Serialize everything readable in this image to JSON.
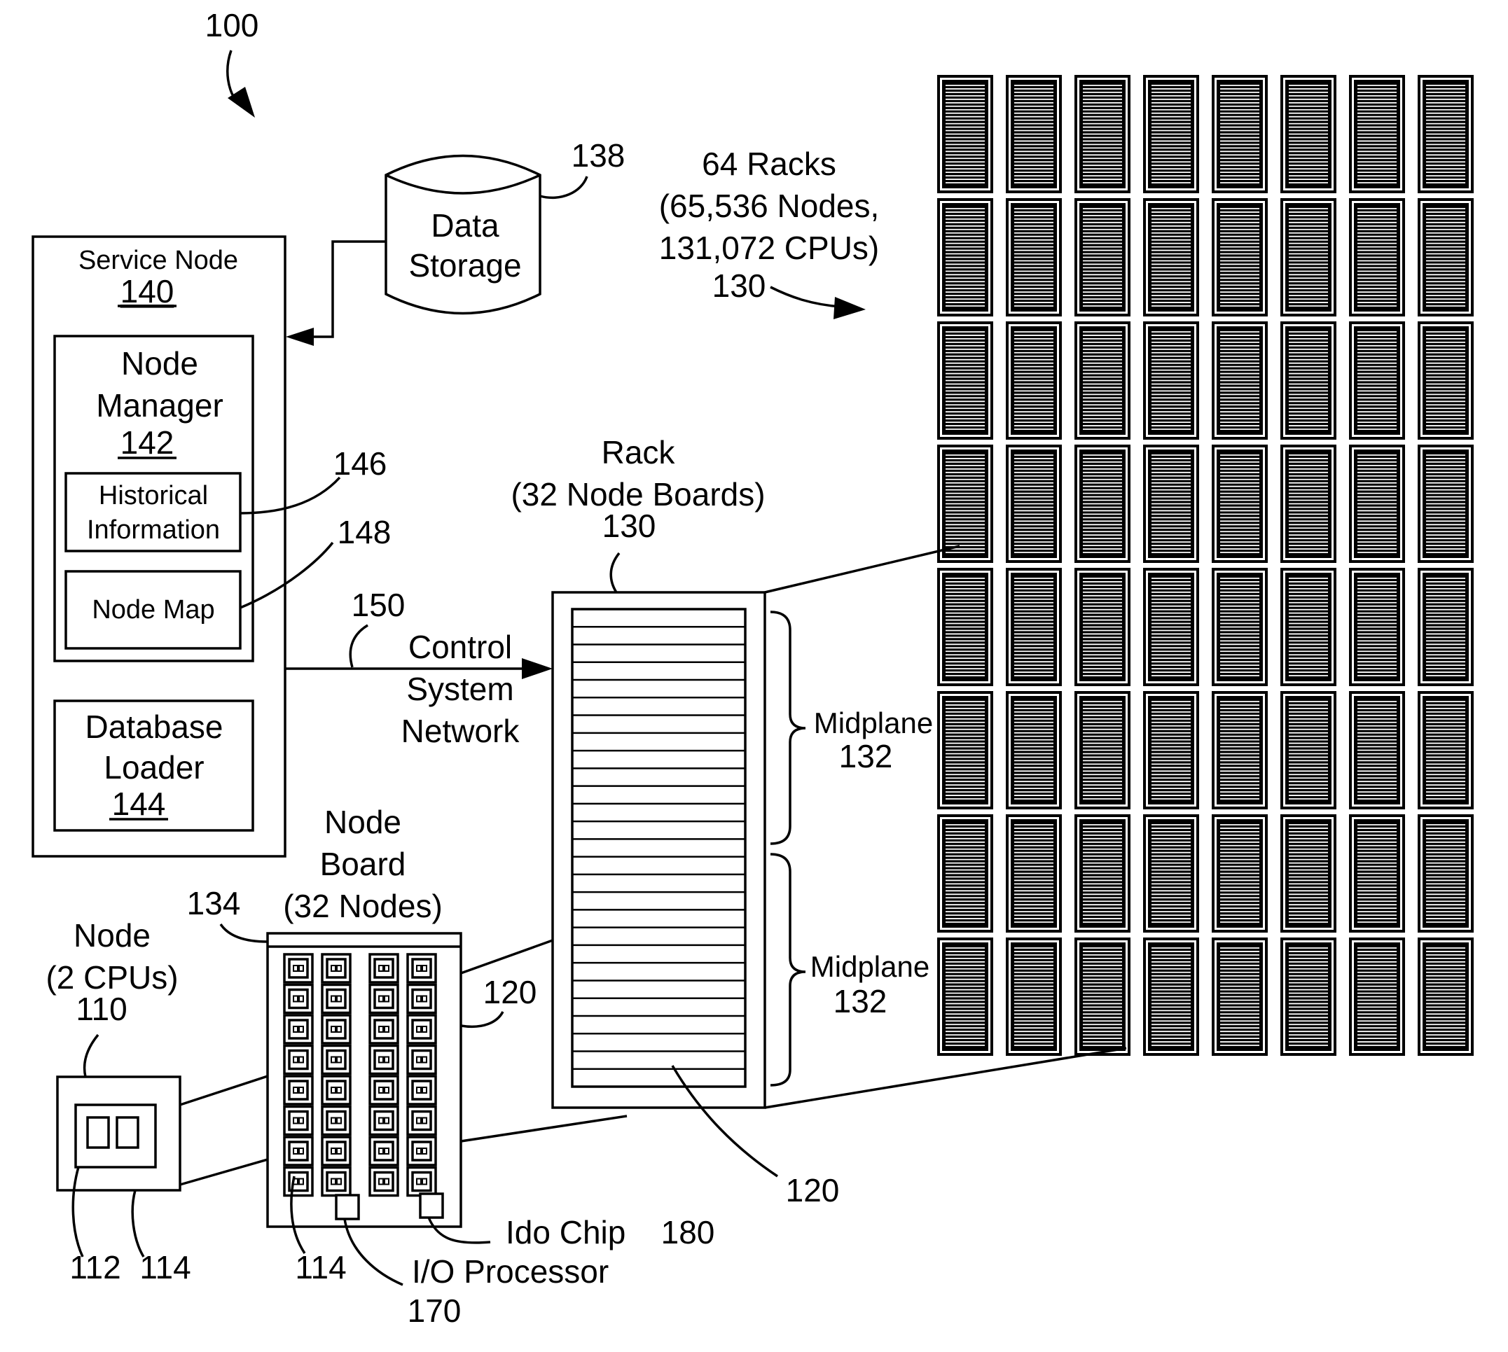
{
  "figure": {
    "ref": "100"
  },
  "data_storage": {
    "line1": "Data",
    "line2": "Storage",
    "ref": "138"
  },
  "service_node": {
    "title": "Service Node",
    "ref": "140",
    "node_manager": {
      "line1": "Node",
      "line2": "Manager",
      "ref": "142"
    },
    "historical_information": {
      "line1": "Historical",
      "line2": "Information",
      "ref": "146"
    },
    "node_map": {
      "label": "Node Map",
      "ref": "148"
    },
    "database_loader": {
      "line1": "Database",
      "line2": "Loader",
      "ref": "144"
    }
  },
  "control_network": {
    "ref": "150",
    "line1": "Control",
    "line2": "System",
    "line3": "Network"
  },
  "racks_system": {
    "line1": "64 Racks",
    "line2": "(65,536 Nodes,",
    "line3": "131,072 CPUs)",
    "ref": "130",
    "columns": 8,
    "rows": 8
  },
  "rack": {
    "line1": "Rack",
    "line2": "(32 Node Boards)",
    "ref": "130",
    "board_ref": "120",
    "midplanes": [
      {
        "label": "Midplane",
        "ref": "132"
      },
      {
        "label": "Midplane",
        "ref": "132"
      }
    ]
  },
  "node_board": {
    "line1": "Node",
    "line2": "Board",
    "line3": "(32 Nodes)",
    "ref": "134",
    "side_ref": "120",
    "node_ref": "114",
    "chip_rows": 8,
    "chip_cols": 4,
    "io_processor": {
      "label": "I/O Processor",
      "ref": "170"
    },
    "ido_chip": {
      "label": "Ido Chip",
      "ref": "180"
    }
  },
  "node": {
    "line1": "Node",
    "line2": "(2 CPUs)",
    "ref": "110",
    "cpu_ref": "112",
    "card_ref": "114"
  }
}
